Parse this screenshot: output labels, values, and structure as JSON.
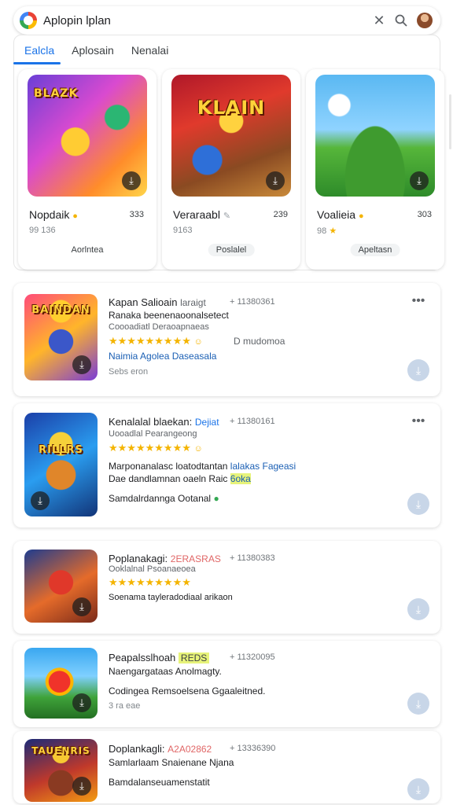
{
  "search": {
    "query": "Aplopin lplan",
    "clear_icon": "close-icon",
    "search_icon": "search-icon"
  },
  "tabs": [
    {
      "label": "Ealcla",
      "active": true
    },
    {
      "label": "Aplosain",
      "active": false
    },
    {
      "label": "Nenalai",
      "active": false
    }
  ],
  "top_cards": [
    {
      "name": "Nopdaik",
      "score": "333",
      "sub": "99 136",
      "pill": "Aorlntea",
      "art_text": "BLAZK"
    },
    {
      "name": "Veraraabl",
      "score": "239",
      "sub": "9163",
      "pill": "Poslalel",
      "art_text": "KLAIN"
    },
    {
      "name": "Voalieia",
      "score": "303",
      "sub": "98",
      "pill": "Apeltasn",
      "art_text": ""
    }
  ],
  "list_items": [
    {
      "art_text": "BAINDAN",
      "title": "Kapan Salioain",
      "tag": "laraigt",
      "count": "+ 11380361",
      "line1": "Ranaka beenenaoonalsetect",
      "line2": "Coooadiatl Deraoapnaeas",
      "stars": "★★★★★★★★★",
      "rating_text": "D mudomoa",
      "line3": "Naimia Agolea Daseasala",
      "line4": "Sebs eron"
    },
    {
      "art_text": "RILLRS",
      "title": "Kenalalal blaekan:",
      "tag": "Dejiat",
      "count": "+ 11380161",
      "line1": "Uooadlal Pearangeong",
      "stars": "★★★★★★★★★",
      "line2": "Marponanalasc loatodtantan",
      "line2_hl": "lalakas Fageasi",
      "line3": "Dae dandlamnan oaeln Raic",
      "line3_hl": "6oka",
      "line4": "Samdalrdannga Ootanal"
    },
    {
      "art_text": "",
      "title": "Poplanakagi:",
      "tag": "2ERASRAS",
      "count": "+ 11380383",
      "line1": "Ooklalnal Psoanaeoea",
      "stars": "★★★★★★★★★",
      "line2": "Soenama tayleradodiaal arikaon"
    },
    {
      "art_text": "",
      "title": "Peapalsslhoah",
      "tag": "REDS",
      "count": "+ 11320095",
      "line1": "Naengargataas Anolmagty.",
      "line2": "Codingea Remsoelsena Ggaaleitned.",
      "line3": "3 ra eae"
    },
    {
      "art_text": "TAUENRIS",
      "title": "Doplankagli:",
      "tag": "A2A02862",
      "count": "+ 13336390",
      "line1": "Samlarlaam Snaienane Njana",
      "line2": "Bamdalanseuamenstatit"
    }
  ]
}
